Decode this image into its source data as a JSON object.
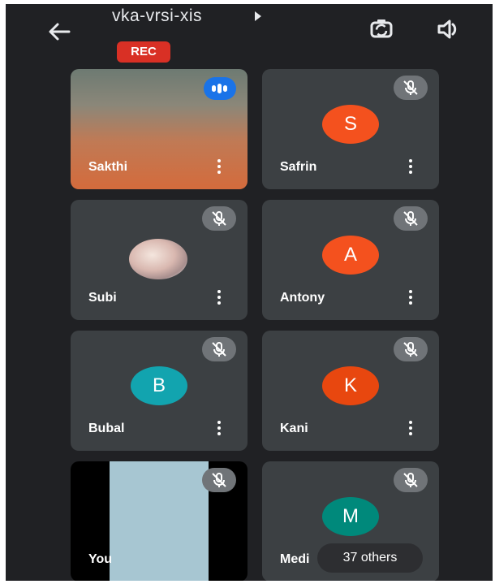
{
  "header": {
    "meeting_code": "vka-vrsi-xis",
    "rec_badge": "REC",
    "icons": {
      "back": "arrow-left-icon",
      "switch_camera": "switch-camera-icon",
      "speaker": "speaker-icon"
    }
  },
  "tiles": [
    {
      "name": "Sakthi",
      "type": "video",
      "status": "speaking"
    },
    {
      "name": "Safrin",
      "initial": "S",
      "avatar_color": "#f4511e",
      "status": "muted"
    },
    {
      "name": "Subi",
      "type": "photo",
      "status": "muted"
    },
    {
      "name": "Antony",
      "initial": "A",
      "avatar_color": "#f4511e",
      "status": "muted"
    },
    {
      "name": "Bubal",
      "initial": "B",
      "avatar_color": "#12a4af",
      "status": "muted"
    },
    {
      "name": "Kani",
      "initial": "K",
      "avatar_color": "#e8470f",
      "status": "muted"
    },
    {
      "name": "You",
      "type": "video",
      "status": "muted"
    },
    {
      "name": "Medi",
      "initial": "M",
      "avatar_color": "#00897b",
      "status": "muted"
    }
  ],
  "others": {
    "label": "37 others"
  }
}
